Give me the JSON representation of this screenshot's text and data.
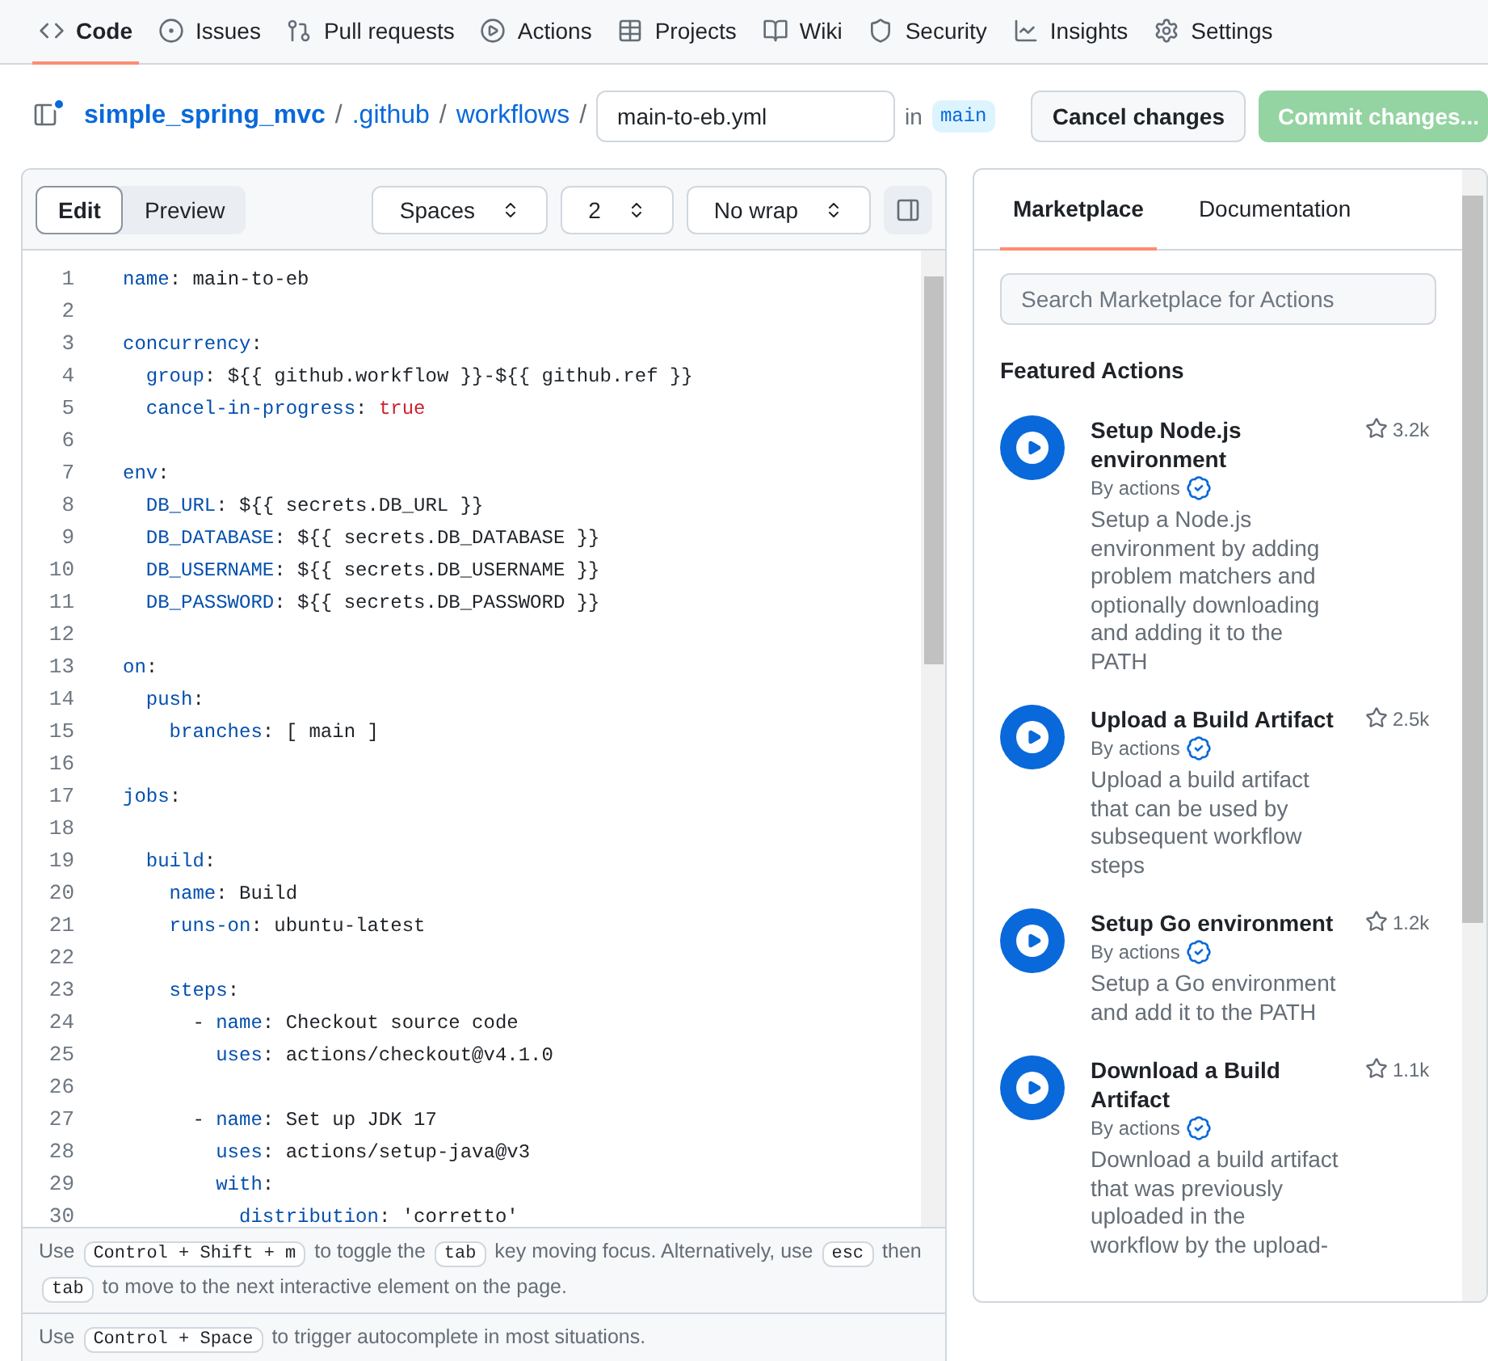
{
  "nav": [
    {
      "kind": "code",
      "label": "Code",
      "selected": true
    },
    {
      "kind": "issues",
      "label": "Issues",
      "selected": false
    },
    {
      "kind": "pulls",
      "label": "Pull requests",
      "selected": false
    },
    {
      "kind": "actions",
      "label": "Actions",
      "selected": false
    },
    {
      "kind": "projects",
      "label": "Projects",
      "selected": false
    },
    {
      "kind": "wiki",
      "label": "Wiki",
      "selected": false
    },
    {
      "kind": "security",
      "label": "Security",
      "selected": false
    },
    {
      "kind": "insights",
      "label": "Insights",
      "selected": false
    },
    {
      "kind": "settings",
      "label": "Settings",
      "selected": false
    }
  ],
  "breadcrumb": {
    "repo": "simple_spring_mvc",
    "folders": [
      ".github",
      "workflows"
    ],
    "separator": "/",
    "filename": "main-to-eb.yml",
    "in_label": "in",
    "branch": "main"
  },
  "buttons": {
    "cancel": "Cancel changes",
    "commit": "Commit changes...",
    "commit_disabled": true
  },
  "editor": {
    "modes": [
      {
        "label": "Edit",
        "selected": true
      },
      {
        "label": "Preview",
        "selected": false
      }
    ],
    "selects": [
      "Spaces",
      "2",
      "No wrap"
    ],
    "lines": [
      {
        "num": "1",
        "tokens": [
          {
            "text": "name",
            "kind": "key"
          },
          {
            "text": ": main-to-eb",
            "kind": "plain"
          }
        ]
      },
      {
        "num": "2"
      },
      {
        "num": "3",
        "tokens": [
          {
            "text": "concurrency",
            "kind": "key"
          },
          {
            "text": ":",
            "kind": "plain"
          }
        ]
      },
      {
        "num": "4",
        "tokens": [
          {
            "text": "  group",
            "kind": "key"
          },
          {
            "text": ": ${{ github.workflow }}-${{ github.ref }}",
            "kind": "plain"
          }
        ]
      },
      {
        "num": "5",
        "tokens": [
          {
            "text": "  cancel-in-progress",
            "kind": "key"
          },
          {
            "text": ": ",
            "kind": "plain"
          },
          {
            "text": "true",
            "kind": "boolean"
          }
        ]
      },
      {
        "num": "6"
      },
      {
        "num": "7",
        "tokens": [
          {
            "text": "env",
            "kind": "key"
          },
          {
            "text": ":",
            "kind": "plain"
          }
        ]
      },
      {
        "num": "8",
        "tokens": [
          {
            "text": "  DB_URL",
            "kind": "key"
          },
          {
            "text": ": ${{ secrets.DB_URL }}",
            "kind": "plain"
          }
        ]
      },
      {
        "num": "9",
        "tokens": [
          {
            "text": "  DB_DATABASE",
            "kind": "key"
          },
          {
            "text": ": ${{ secrets.DB_DATABASE }}",
            "kind": "plain"
          }
        ]
      },
      {
        "num": "10",
        "tokens": [
          {
            "text": "  DB_USERNAME",
            "kind": "key"
          },
          {
            "text": ": ${{ secrets.DB_USERNAME }}",
            "kind": "plain"
          }
        ]
      },
      {
        "num": "11",
        "tokens": [
          {
            "text": "  DB_PASSWORD",
            "kind": "key"
          },
          {
            "text": ": ${{ secrets.DB_PASSWORD }}",
            "kind": "plain"
          }
        ]
      },
      {
        "num": "12"
      },
      {
        "num": "13",
        "tokens": [
          {
            "text": "on",
            "kind": "key"
          },
          {
            "text": ":",
            "kind": "plain"
          }
        ]
      },
      {
        "num": "14",
        "tokens": [
          {
            "text": "  push",
            "kind": "key"
          },
          {
            "text": ":",
            "kind": "plain"
          }
        ]
      },
      {
        "num": "15",
        "tokens": [
          {
            "text": "    branches",
            "kind": "key"
          },
          {
            "text": ": [ main ]",
            "kind": "plain"
          }
        ]
      },
      {
        "num": "16"
      },
      {
        "num": "17",
        "tokens": [
          {
            "text": "jobs",
            "kind": "key"
          },
          {
            "text": ":",
            "kind": "plain"
          }
        ]
      },
      {
        "num": "18"
      },
      {
        "num": "19",
        "tokens": [
          {
            "text": "  build",
            "kind": "key"
          },
          {
            "text": ":",
            "kind": "plain"
          }
        ]
      },
      {
        "num": "20",
        "tokens": [
          {
            "text": "    name",
            "kind": "key"
          },
          {
            "text": ": Build",
            "kind": "plain"
          }
        ]
      },
      {
        "num": "21",
        "tokens": [
          {
            "text": "    runs-on",
            "kind": "key"
          },
          {
            "text": ": ubuntu-latest",
            "kind": "plain"
          }
        ]
      },
      {
        "num": "22"
      },
      {
        "num": "23",
        "tokens": [
          {
            "text": "    steps",
            "kind": "key"
          },
          {
            "text": ":",
            "kind": "plain"
          }
        ]
      },
      {
        "num": "24",
        "tokens": [
          {
            "text": "      - ",
            "kind": "plain"
          },
          {
            "text": "name",
            "kind": "key"
          },
          {
            "text": ": Checkout source code",
            "kind": "plain"
          }
        ]
      },
      {
        "num": "25",
        "tokens": [
          {
            "text": "        uses",
            "kind": "key"
          },
          {
            "text": ": actions/checkout@v4.1.0",
            "kind": "plain"
          }
        ]
      },
      {
        "num": "26"
      },
      {
        "num": "27",
        "tokens": [
          {
            "text": "      - ",
            "kind": "plain"
          },
          {
            "text": "name",
            "kind": "key"
          },
          {
            "text": ": Set up JDK 17",
            "kind": "plain"
          }
        ]
      },
      {
        "num": "28",
        "tokens": [
          {
            "text": "        uses",
            "kind": "key"
          },
          {
            "text": ": actions/setup-java@v3",
            "kind": "plain"
          }
        ]
      },
      {
        "num": "29",
        "tokens": [
          {
            "text": "        with",
            "kind": "key"
          },
          {
            "text": ":",
            "kind": "plain"
          }
        ]
      },
      {
        "num": "30",
        "tokens": [
          {
            "text": "          distribution",
            "kind": "key"
          },
          {
            "text": ": 'corretto'",
            "kind": "plain"
          }
        ]
      }
    ],
    "hints": [
      [
        {
          "text": "Use"
        },
        {
          "key": "Control + Shift + m"
        },
        {
          "text": "to toggle the"
        },
        {
          "key": "tab"
        },
        {
          "text": "key moving focus. Alternatively, use"
        },
        {
          "key": "esc"
        },
        {
          "text": "then"
        },
        {
          "key": "tab"
        },
        {
          "text": "to move to the next interactive element on the page."
        }
      ],
      [
        {
          "text": "Use"
        },
        {
          "key": "Control + Space"
        },
        {
          "text": "to trigger autocomplete in most situations."
        }
      ]
    ]
  },
  "sidebar": {
    "tabs": [
      {
        "label": "Marketplace",
        "selected": true
      },
      {
        "label": "Documentation",
        "selected": false
      }
    ],
    "search": {
      "placeholder": "Search Marketplace for Actions"
    },
    "heading": "Featured Actions",
    "actions": [
      {
        "title": "Setup Node.js environment",
        "by": "By actions",
        "verified": true,
        "stars": "3.2k",
        "description": "Setup a Node.js environment by adding problem matchers and optionally downloading and adding it to the PATH"
      },
      {
        "title": "Upload a Build Artifact",
        "by": "By actions",
        "verified": true,
        "stars": "2.5k",
        "description": "Upload a build artifact that can be used by subsequent workflow steps"
      },
      {
        "title": "Setup Go environment",
        "by": "By actions",
        "verified": true,
        "stars": "1.2k",
        "description": "Setup a Go environment and add it to the PATH"
      },
      {
        "title": "Download a Build Artifact",
        "by": "By actions",
        "verified": true,
        "stars": "1.1k",
        "description": "Download a build artifact that was previously uploaded in the workflow by the upload-"
      }
    ]
  }
}
